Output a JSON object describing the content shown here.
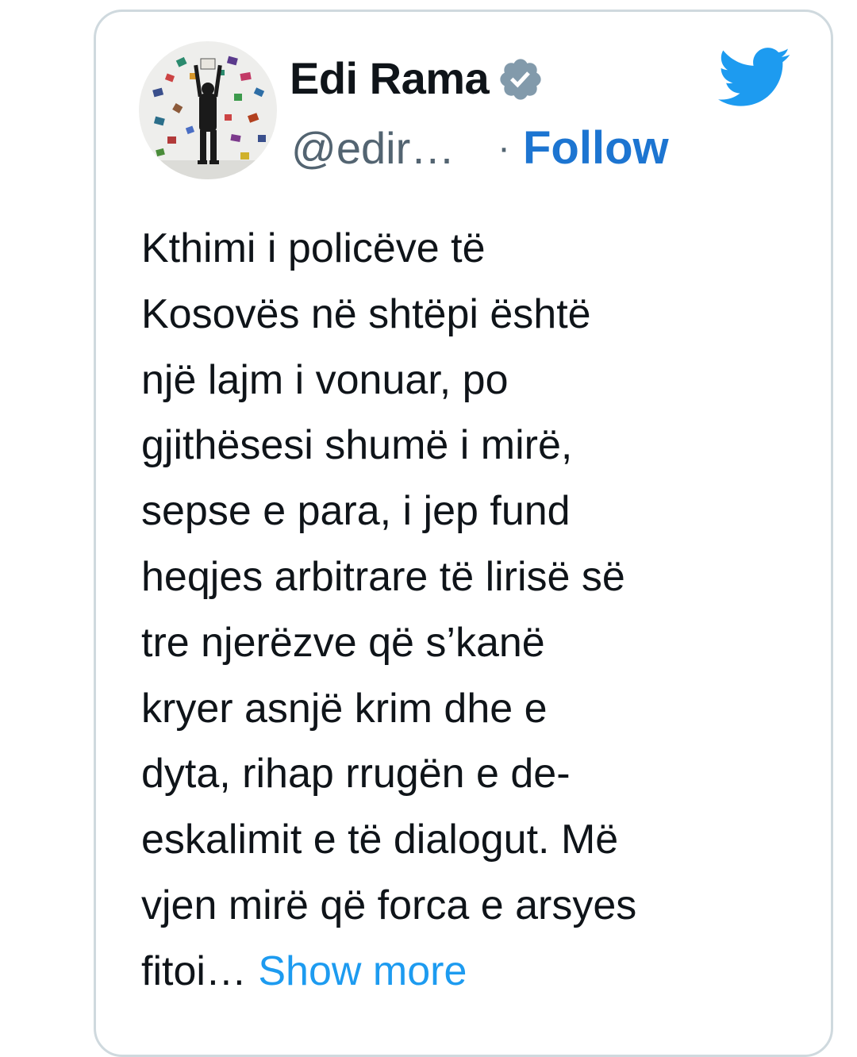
{
  "author": {
    "name": "Edi Rama",
    "handle": "@edir…",
    "separator": "·",
    "follow_label": "Follow",
    "verified_icon": "verified-badge-icon",
    "avatar_icon": "profile-photo"
  },
  "platform_icon": "twitter-bird-icon",
  "colors": {
    "follow": "#1d75d1",
    "show_more": "#1d9bf0",
    "twitter_blue": "#1d9bf0",
    "verified_badge": "#829aab",
    "border": "#cfd9de"
  },
  "tweet": {
    "lines": [
      "Kthimi i policëve të",
      "Kosovës në shtëpi është",
      "një lajm i vonuar, po",
      "gjithësesi shumë i mirë,",
      "sepse e para, i jep fund",
      "heqjes arbitrare të lirisë së",
      "tre njerëzve që s’kanë",
      "kryer asnjë krim dhe e",
      "dyta, rihap rrugën e de-",
      "eskalimit e të dialogut. Më",
      "vjen mirë që forca e arsyes"
    ],
    "last_line": "fitoi…",
    "show_more_label": "Show more"
  }
}
